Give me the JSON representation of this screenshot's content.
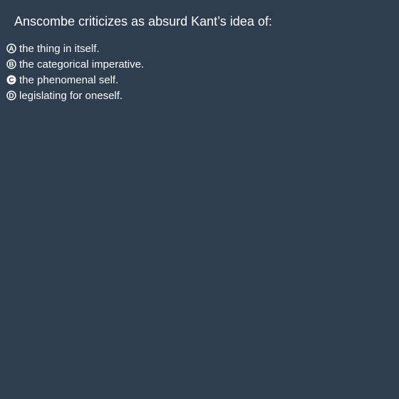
{
  "question": {
    "text": "Anscombe criticizes as absurd Kant’s idea of:"
  },
  "options": [
    {
      "letter": "A",
      "text": "the thing in itself.",
      "selected": false
    },
    {
      "letter": "B",
      "text": "the categorical imperative.",
      "selected": false
    },
    {
      "letter": "C",
      "text": "the phenomenal self.",
      "selected": true
    },
    {
      "letter": "D",
      "text": "legislating for oneself.",
      "selected": false
    }
  ],
  "colors": {
    "background": "#2e3d4f",
    "text": "#ffffff"
  }
}
